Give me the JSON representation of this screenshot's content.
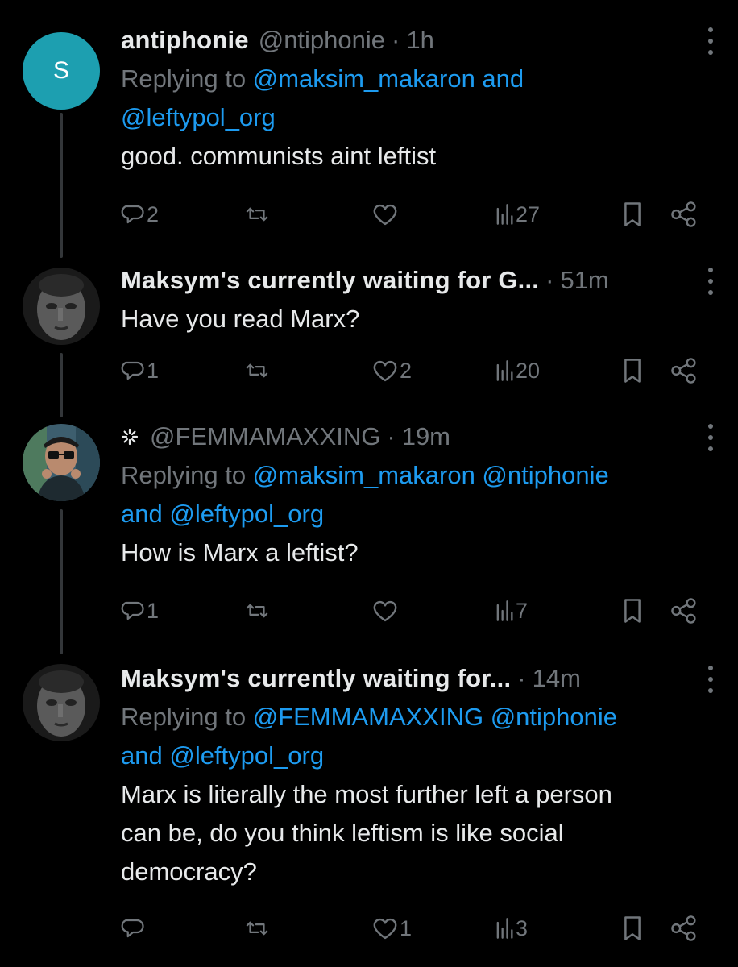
{
  "colors": {
    "background": "#000000",
    "text": "#e7e9ea",
    "muted": "#71767b",
    "mention": "#1d9bf0",
    "avatar_s": "#1d9fb0",
    "thread_line": "#333639"
  },
  "tweets": [
    {
      "avatar_letter": "S",
      "display_name": "antiphonie",
      "handle": "@ntiphonie",
      "time": "1h",
      "replying_prefix": "Replying to ",
      "replying_line1": "@maksim_makaron and",
      "replying_line2": "@leftypol_org",
      "body": [
        "good. communists aint leftist"
      ],
      "replies": "2",
      "retweets": "",
      "likes": "",
      "views": "27"
    },
    {
      "display_name": "Maksym's currently waiting for G...",
      "time": "51m",
      "body": [
        "Have you read Marx?"
      ],
      "replies": "1",
      "retweets": "",
      "likes": "2",
      "views": "20"
    },
    {
      "display_name": "@FEMMAMAXXING",
      "time": "19m",
      "replying_prefix": "Replying to ",
      "replying_line1": "@maksim_makaron @ntiphonie",
      "replying_line2_and": "and ",
      "replying_line2": "@leftypol_org",
      "body": [
        "How is Marx a leftist?"
      ],
      "replies": "1",
      "retweets": "",
      "likes": "",
      "views": "7"
    },
    {
      "display_name": "Maksym's currently waiting for...",
      "time": "14m",
      "replying_prefix": "Replying to ",
      "replying_line1": "@FEMMAMAXXING @ntiphonie",
      "replying_line2_and": "and ",
      "replying_line2": "@leftypol_org",
      "body": [
        "Marx is literally the most further left a person",
        "can be, do you think leftism is like social",
        "democracy?"
      ],
      "replies": "",
      "retweets": "",
      "likes": "1",
      "views": "3"
    }
  ],
  "icons": {
    "reply": "reply-icon",
    "retweet": "retweet-icon",
    "like": "heart-icon",
    "views": "views-chart-icon",
    "bookmark": "bookmark-icon",
    "share": "share-icon",
    "more": "more-vertical-icon"
  }
}
